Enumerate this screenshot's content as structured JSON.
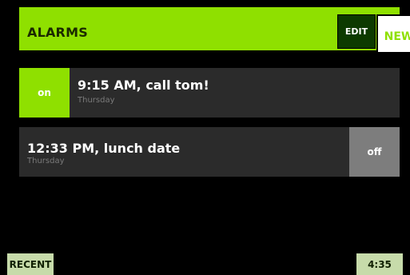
{
  "header": {
    "title": "ALARMS",
    "edit_label": "EDIT",
    "new_label": "NEW"
  },
  "alarms": [
    {
      "title": "9:15 AM, call tom!",
      "day": "Thursday",
      "toggle": "on"
    },
    {
      "title": "12:33 PM, lunch date",
      "day": "Thursday",
      "toggle": "off"
    }
  ],
  "footer": {
    "recent_label": "RECENT",
    "clock": "4:35"
  },
  "colors": {
    "accent": "#8fe000",
    "row_background": "#2b2b2b",
    "off_toggle": "#7d7d7d",
    "footer_button": "#c7dbaa"
  }
}
